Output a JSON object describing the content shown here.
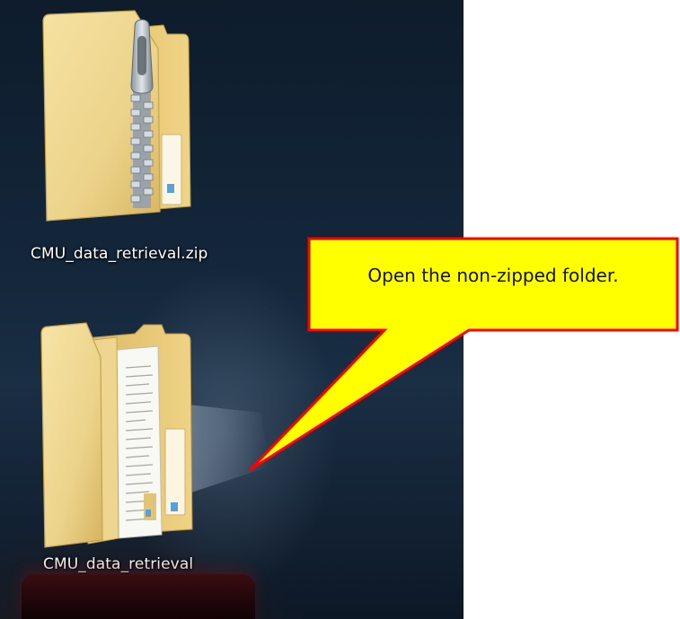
{
  "desktop": {
    "icons": [
      {
        "label": "CMU_data_retrieval.zip",
        "icon": "zip-folder-icon"
      },
      {
        "label": "CMU_data_retrieval",
        "icon": "folder-icon"
      }
    ]
  },
  "callout": {
    "text": "Open the non-zipped folder.",
    "fill_color": "#ffff00",
    "border_color": "#ff0000"
  }
}
